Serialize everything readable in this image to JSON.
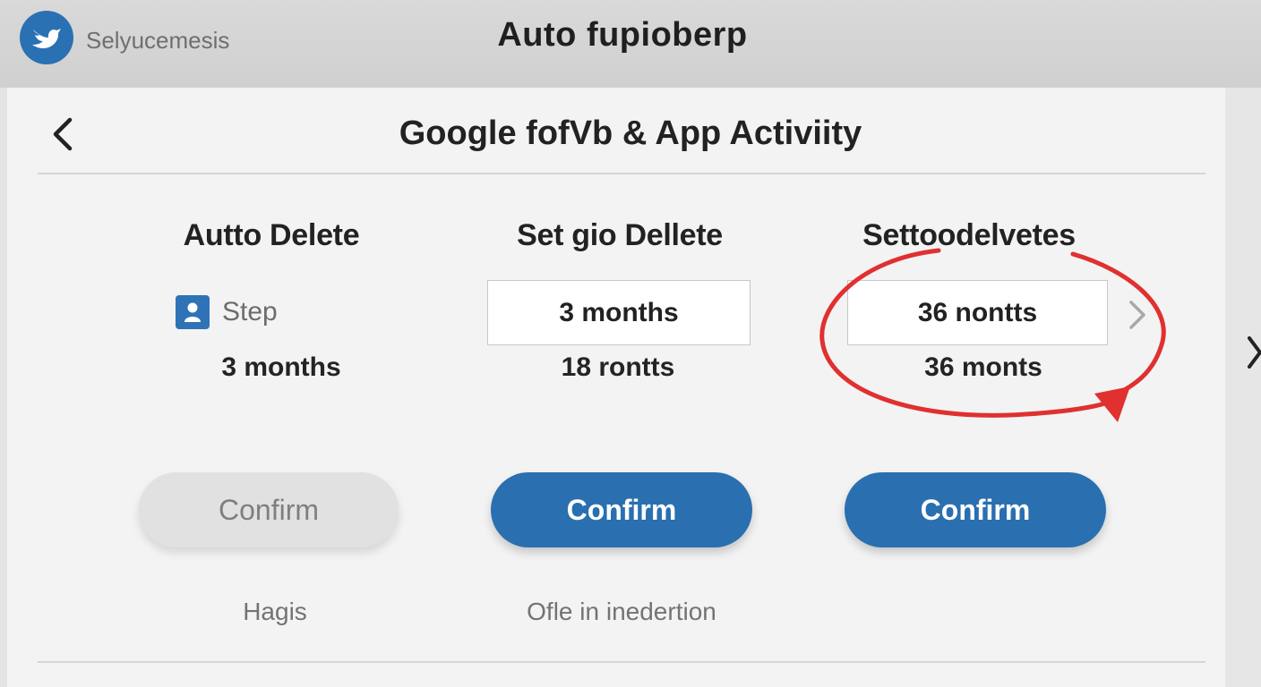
{
  "app": {
    "name": "Selyucemesis",
    "logo_icon": "bird-logo-icon",
    "window_title": "Auto fupioberp"
  },
  "page": {
    "title": "Google fofVb & App Activiity",
    "back_icon": "chevron-left-icon"
  },
  "columns": [
    {
      "heading": "Autto Delete",
      "step_label": "Step",
      "step_icon": "user-badge-icon",
      "value": "3 months",
      "confirm_label": "Confirm",
      "confirm_state": "disabled",
      "caption": "Hagis"
    },
    {
      "heading": "Set gio Dellete",
      "select_value": "3 months",
      "value": "18 rontts",
      "confirm_label": "Confirm",
      "confirm_state": "enabled",
      "caption": "Ofle in inedertion"
    },
    {
      "heading": "Settoodelvetes",
      "select_value": "36 nontts",
      "value": "36 monts",
      "confirm_label": "Confirm",
      "confirm_state": "enabled",
      "next_icon": "chevron-right-icon"
    }
  ],
  "annotation": {
    "shape": "red-circle-with-arrow",
    "color": "#e03030"
  },
  "colors": {
    "accent": "#2a6fb0",
    "topbar": "#d4d4d4",
    "panel": "#f3f3f3"
  }
}
